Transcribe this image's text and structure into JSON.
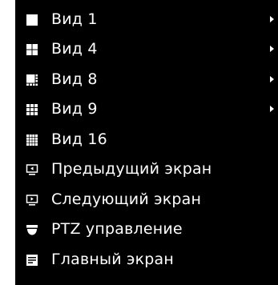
{
  "menu": {
    "items": [
      {
        "label": "Вид 1",
        "icon": "single-view-icon",
        "submenu": true
      },
      {
        "label": "Вид 4",
        "icon": "quad-view-icon",
        "submenu": true
      },
      {
        "label": "Вид 8",
        "icon": "eight-view-icon",
        "submenu": true
      },
      {
        "label": "Вид 9",
        "icon": "nine-view-icon",
        "submenu": true
      },
      {
        "label": "Вид 16",
        "icon": "sixteen-view-icon",
        "submenu": false
      },
      {
        "label": "Предыдущий экран",
        "icon": "previous-screen-icon",
        "submenu": false
      },
      {
        "label": "Следующий экран",
        "icon": "next-screen-icon",
        "submenu": false
      },
      {
        "label": "PTZ управление",
        "icon": "ptz-camera-icon",
        "submenu": false
      },
      {
        "label": "Главный экран",
        "icon": "main-menu-icon",
        "submenu": false
      }
    ]
  },
  "colors": {
    "menu_bg": "#000000",
    "text": "#ffffff"
  }
}
